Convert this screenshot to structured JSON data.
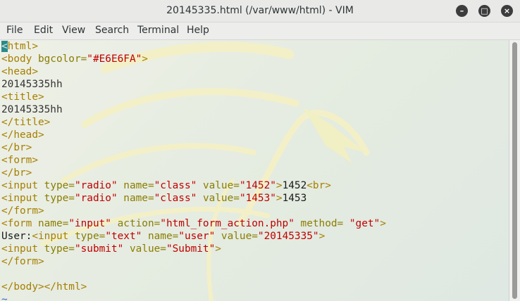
{
  "window": {
    "title": "20145335.html (/var/www/html) - VIM",
    "minimize_icon": "minimize-icon",
    "maximize_icon": "maximize-icon",
    "close_icon": "close-icon"
  },
  "menu": {
    "items": [
      "File",
      "Edit",
      "View",
      "Search",
      "Terminal",
      "Help"
    ]
  },
  "colors": {
    "tag": "#a67f00",
    "string": "#c00000",
    "text": "#1a1a1a",
    "cursor": "#2a8a8a"
  },
  "code": {
    "lines": [
      [
        {
          "t": "<",
          "c": "cursor"
        },
        {
          "t": "html>",
          "c": "tag"
        }
      ],
      [
        {
          "t": "<body ",
          "c": "tag"
        },
        {
          "t": "bgcolor=",
          "c": "attr"
        },
        {
          "t": "\"#E6E6FA\"",
          "c": "str"
        },
        {
          "t": ">",
          "c": "tag"
        }
      ],
      [
        {
          "t": "<head>",
          "c": "tag"
        }
      ],
      [
        {
          "t": "20145335hh",
          "c": "dim"
        }
      ],
      [
        {
          "t": "<title>",
          "c": "tag"
        }
      ],
      [
        {
          "t": "20145335hh",
          "c": "dim"
        }
      ],
      [
        {
          "t": "</title>",
          "c": "tag"
        }
      ],
      [
        {
          "t": "</head>",
          "c": "tag"
        }
      ],
      [
        {
          "t": "</br>",
          "c": "tag"
        }
      ],
      [
        {
          "t": "<form>",
          "c": "tag"
        }
      ],
      [
        {
          "t": "</br>",
          "c": "tag"
        }
      ],
      [
        {
          "t": "<input ",
          "c": "tag"
        },
        {
          "t": "type=",
          "c": "attr"
        },
        {
          "t": "\"radio\"",
          "c": "str"
        },
        {
          "t": " name=",
          "c": "attr"
        },
        {
          "t": "\"class\"",
          "c": "str"
        },
        {
          "t": " value=",
          "c": "attr"
        },
        {
          "t": "\"1452\"",
          "c": "str"
        },
        {
          "t": ">",
          "c": "tag"
        },
        {
          "t": "1452",
          "c": "txt"
        },
        {
          "t": "<br>",
          "c": "tag"
        }
      ],
      [
        {
          "t": "<input ",
          "c": "tag"
        },
        {
          "t": "type=",
          "c": "attr"
        },
        {
          "t": "\"radio\"",
          "c": "str"
        },
        {
          "t": " name=",
          "c": "attr"
        },
        {
          "t": "\"class\"",
          "c": "str"
        },
        {
          "t": " value=",
          "c": "attr"
        },
        {
          "t": "\"1453\"",
          "c": "str"
        },
        {
          "t": ">",
          "c": "tag"
        },
        {
          "t": "1453",
          "c": "txt"
        }
      ],
      [
        {
          "t": "</form>",
          "c": "tag"
        }
      ],
      [
        {
          "t": "<form ",
          "c": "tag"
        },
        {
          "t": "name=",
          "c": "attr"
        },
        {
          "t": "\"input\"",
          "c": "str"
        },
        {
          "t": " action=",
          "c": "attr"
        },
        {
          "t": "\"html_form_action.php\"",
          "c": "str"
        },
        {
          "t": " method=",
          "c": "attr"
        },
        {
          "t": " \"get\"",
          "c": "str"
        },
        {
          "t": ">",
          "c": "tag"
        }
      ],
      [
        {
          "t": "User:",
          "c": "txt"
        },
        {
          "t": "<input ",
          "c": "tag"
        },
        {
          "t": "type=",
          "c": "attr"
        },
        {
          "t": "\"text\"",
          "c": "str"
        },
        {
          "t": " name=",
          "c": "attr"
        },
        {
          "t": "\"user\"",
          "c": "str"
        },
        {
          "t": " value=",
          "c": "attr"
        },
        {
          "t": "\"20145335\"",
          "c": "str"
        },
        {
          "t": ">",
          "c": "tag"
        }
      ],
      [
        {
          "t": "<input ",
          "c": "tag"
        },
        {
          "t": "type=",
          "c": "attr"
        },
        {
          "t": "\"submit\"",
          "c": "str"
        },
        {
          "t": " value=",
          "c": "attr"
        },
        {
          "t": "\"Submit\"",
          "c": "str"
        },
        {
          "t": ">",
          "c": "tag"
        }
      ],
      [
        {
          "t": "</form>",
          "c": "tag"
        }
      ],
      [],
      [
        {
          "t": "</body></html>",
          "c": "tag"
        }
      ],
      [
        {
          "t": "~",
          "c": "tilde"
        }
      ]
    ]
  }
}
